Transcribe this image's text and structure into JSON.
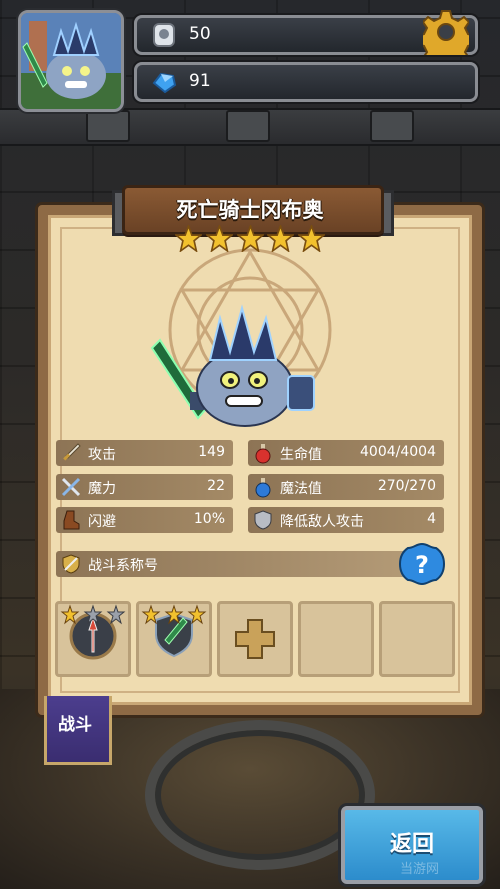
{
  "currency": {
    "tokens": "50",
    "gems": "91"
  },
  "hero": {
    "name": "死亡骑士冈布奥",
    "star_count": 5
  },
  "stats": {
    "attack_label": "攻击",
    "attack_value": "149",
    "magic_label": "魔力",
    "magic_value": "22",
    "dodge_label": "闪避",
    "dodge_value": "10%",
    "hp_label": "生命值",
    "hp_value": "4004/4004",
    "mp_label": "魔法值",
    "mp_value": "270/270",
    "reduce_label": "降低敌人攻击",
    "reduce_value": "4"
  },
  "combat_title_label": "战斗系称号",
  "equipment": [
    {
      "item": "spear-badge",
      "stars": "1 of 3"
    },
    {
      "item": "dagger-badge",
      "stars": "3 of 3"
    },
    {
      "item": "empty-plus"
    },
    {
      "item": "empty"
    },
    {
      "item": "empty"
    }
  ],
  "tab_label": "战斗",
  "back_label": "返回",
  "watermark": "当游网",
  "colors": {
    "panel": "#efdcb0",
    "stat_bar": "#a48a66",
    "back_button": "#2c8ccc",
    "tab": "#4c3e8e",
    "star": "#f2c12e"
  }
}
